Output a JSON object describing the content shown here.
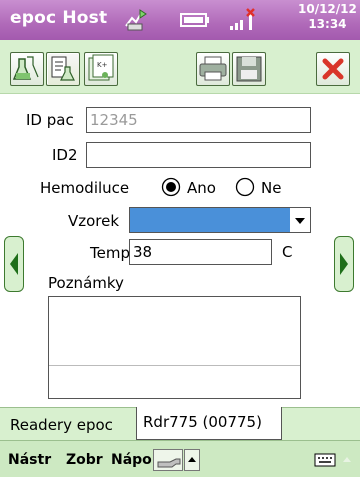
{
  "titlebar": {
    "title": "epoc Host",
    "date": "10/12/12",
    "time": "13:34"
  },
  "form": {
    "id_pac_label": "ID pac",
    "id_pac_placeholder": "12345",
    "id2_label": "ID2",
    "id2_value": "",
    "hemodiluce_label": "Hemodiluce",
    "hemodiluce_options": [
      "Ano",
      "Ne"
    ],
    "hemodiluce_selected": "Ano",
    "vzorek_label": "Vzorek",
    "vzorek_value": "",
    "temp_label": "Temp",
    "temp_value": "38",
    "temp_unit": "C",
    "poznamky_label": "Poznámky",
    "poznamky_value": ""
  },
  "tabs": [
    {
      "label": "Readery epoc",
      "active": false
    },
    {
      "label": "Rdr775 (00775)",
      "active": true
    }
  ],
  "menubar": {
    "items": [
      "Nástr",
      "Zobr",
      "Nápo"
    ]
  },
  "colors": {
    "title_bar": "#b06ab9",
    "toolbar_bg": "#d8f0cf",
    "selection_blue": "#4a90d9",
    "close_red": "#d9352a"
  }
}
